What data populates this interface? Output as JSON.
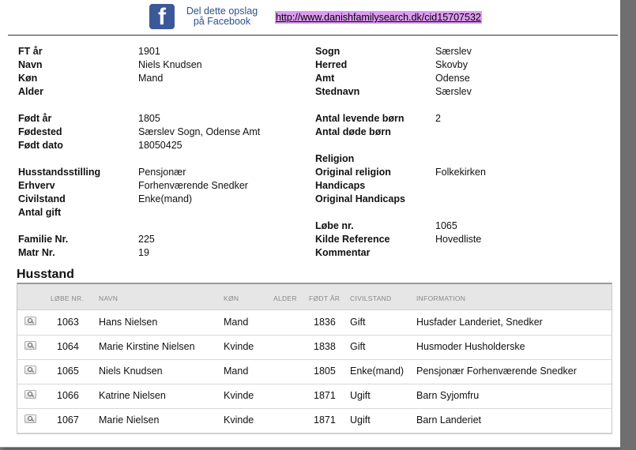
{
  "facebook": {
    "share_text": "Del dette opslag på Facebook",
    "logo_letter": "f"
  },
  "url": "http://www.danishfamilysearch.dk/cid15707532",
  "left_fields": [
    {
      "label": "FT år",
      "value": "1901"
    },
    {
      "label": "Navn",
      "value": "Niels Knudsen"
    },
    {
      "label": "Køn",
      "value": "Mand"
    },
    {
      "label": "Alder",
      "value": ""
    },
    {
      "label": "Født år",
      "value": "1805"
    },
    {
      "label": "Fødested",
      "value": "Særslev Sogn, Odense Amt"
    },
    {
      "label": "Født dato",
      "value": "18050425"
    },
    {
      "label": "Husstandsstilling",
      "value": "Pensjonær"
    },
    {
      "label": "Erhverv",
      "value": "Forhenværende Snedker"
    },
    {
      "label": "Civilstand",
      "value": "Enke(mand)"
    },
    {
      "label": "Antal gift",
      "value": ""
    },
    {
      "label": "Familie Nr.",
      "value": "225"
    },
    {
      "label": "Matr Nr.",
      "value": "19"
    }
  ],
  "right_fields": [
    {
      "label": "Sogn",
      "value": "Særslev"
    },
    {
      "label": "Herred",
      "value": "Skovby"
    },
    {
      "label": "Amt",
      "value": "Odense"
    },
    {
      "label": "Stednavn",
      "value": "Særslev"
    },
    {
      "label": "Antal levende børn",
      "value": "2"
    },
    {
      "label": "Antal døde børn",
      "value": ""
    },
    {
      "label": "Religion",
      "value": ""
    },
    {
      "label": "Original religion",
      "value": "Folkekirken"
    },
    {
      "label": "Handicaps",
      "value": ""
    },
    {
      "label": "Original Handicaps",
      "value": ""
    },
    {
      "label": "Løbe nr.",
      "value": "1065"
    },
    {
      "label": "Kilde Reference",
      "value": "Hovedliste"
    },
    {
      "label": "Kommentar",
      "value": ""
    }
  ],
  "household": {
    "title": "Husstand",
    "columns": [
      "LØBE NR.",
      "NAVN",
      "KØN",
      "ALDER",
      "FØDT ÅR",
      "CIVILSTAND",
      "INFORMATION"
    ],
    "rows": [
      [
        "1063",
        "Hans Nielsen",
        "Mand",
        "",
        "1836",
        "Gift",
        "Husfader Landeriet, Snedker"
      ],
      [
        "1064",
        "Marie Kirstine Nielsen",
        "Kvinde",
        "",
        "1838",
        "Gift",
        "Husmoder Husholderske"
      ],
      [
        "1065",
        "Niels Knudsen",
        "Mand",
        "",
        "1805",
        "Enke(mand)",
        "Pensjonær Forhenværende Snedker"
      ],
      [
        "1066",
        "Katrine Nielsen",
        "Kvinde",
        "",
        "1871",
        "Ugift",
        "Barn Syjomfru"
      ],
      [
        "1067",
        "Marie Nielsen",
        "Kvinde",
        "",
        "1871",
        "Ugift",
        "Barn Landeriet"
      ]
    ]
  }
}
